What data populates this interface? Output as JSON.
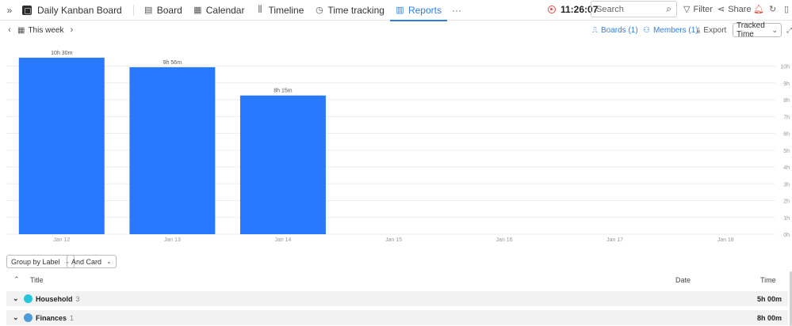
{
  "topbar": {
    "board_title": "Daily Kanban Board",
    "nav": [
      {
        "label": "Board",
        "icon": "board-icon"
      },
      {
        "label": "Calendar",
        "icon": "calendar-icon"
      },
      {
        "label": "Timeline",
        "icon": "timeline-icon"
      },
      {
        "label": "Time tracking",
        "icon": "clock-icon"
      },
      {
        "label": "Reports",
        "icon": "bar-chart-icon",
        "active": true
      }
    ],
    "more_label": "···",
    "timer": "11:26:07",
    "search_placeholder": "Search",
    "filter_label": "Filter",
    "share_label": "Share"
  },
  "subbar": {
    "week_label": "This week",
    "boards_label": "Boards (1)",
    "members_label": "Members (1)",
    "export_label": "Export",
    "metric_select": "Tracked Time"
  },
  "chart_data": {
    "type": "bar",
    "categories": [
      "Jan 12",
      "Jan 13",
      "Jan 14",
      "Jan 15",
      "Jan 16",
      "Jan 17",
      "Jan 18"
    ],
    "values_hours": [
      10.5,
      9.9333,
      8.25,
      0,
      0,
      0,
      0
    ],
    "data_labels": [
      "10h 30m",
      "9h 56m",
      "8h 15m",
      "",
      "",
      "",
      ""
    ],
    "y_ticks": [
      "0h",
      "1h",
      "2h",
      "3h",
      "4h",
      "5h",
      "6h",
      "7h",
      "8h",
      "9h",
      "10h"
    ],
    "ylim": [
      0,
      10
    ],
    "grid": true,
    "bar_color": "#2979ff"
  },
  "grouping": {
    "group_by_label": "Group by Label",
    "and_card_label": "And Card"
  },
  "table": {
    "headers": {
      "title": "Title",
      "date": "Date",
      "time": "Time"
    },
    "rows": [
      {
        "name": "Household",
        "count": "3",
        "time": "5h 00m",
        "color": "#26c6da"
      },
      {
        "name": "Finances",
        "count": "1",
        "time": "8h 00m",
        "color": "#4f9bd9"
      }
    ]
  }
}
